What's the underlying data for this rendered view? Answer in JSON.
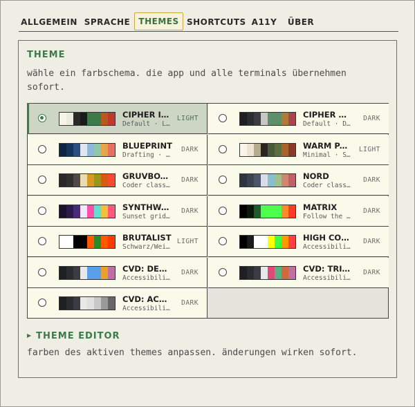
{
  "tabs": [
    {
      "label": "ALLGEMEIN",
      "active": false
    },
    {
      "label": "SPRACHE",
      "active": false
    },
    {
      "label": "THEMES",
      "active": true
    },
    {
      "label": "SHORTCUTS",
      "active": false
    },
    {
      "label": "A11Y",
      "active": false
    },
    {
      "label": "ÜBER",
      "active": false
    }
  ],
  "theme_section": {
    "title": "THEME",
    "description": "wähle ein farbschema. die app und alle terminals übernehmen sofort."
  },
  "themes": [
    {
      "name": "CIPHER IVORY",
      "sub": "Default · Light",
      "mode": "LIGHT",
      "selected": true,
      "colors": [
        "#f7f5e8",
        "#ecebdd",
        "#2a2a2a",
        "#1a1a1a",
        "#3d7a4a",
        "#3d7a4a",
        "#b85a1e",
        "#c0392b"
      ]
    },
    {
      "name": "CIPHER DARK",
      "sub": "Default · Dark",
      "mode": "DARK",
      "selected": false,
      "colors": [
        "#1e1f22",
        "#2a2c30",
        "#3a3c42",
        "#c8c8c0",
        "#5f8f6a",
        "#5f8f6a",
        "#b07a3a",
        "#a8454f"
      ]
    },
    {
      "name": "BLUEPRINT",
      "sub": "Drafting · Dark",
      "mode": "DARK",
      "selected": false,
      "colors": [
        "#0e2440",
        "#16355a",
        "#2a4f80",
        "#dfe7f2",
        "#8fb8d8",
        "#8fc8a8",
        "#e8a44a",
        "#e87060"
      ]
    },
    {
      "name": "WARM PAPER",
      "sub": "Minimal · Sepia",
      "mode": "LIGHT",
      "selected": false,
      "colors": [
        "#f8f4ea",
        "#ede5d2",
        "#b5a98e",
        "#2a2520",
        "#4a5a3a",
        "#5e6e3e",
        "#a8642a",
        "#8a3a2a"
      ]
    },
    {
      "name": "GRUVBOX DARK",
      "sub": "Coder classic",
      "mode": "DARK",
      "selected": false,
      "colors": [
        "#282828",
        "#32302f",
        "#504945",
        "#ebdbb2",
        "#d79921",
        "#98971a",
        "#d65d0e",
        "#fb4934"
      ]
    },
    {
      "name": "NORD",
      "sub": "Coder classic",
      "mode": "DARK",
      "selected": false,
      "colors": [
        "#2e3440",
        "#3b4252",
        "#4c566a",
        "#d8dee9",
        "#88c0d0",
        "#a3be8c",
        "#d08770",
        "#bf616a"
      ]
    },
    {
      "name": "SYNTHWAVE",
      "sub": "Sunset grid · Neon",
      "mode": "DARK",
      "selected": false,
      "colors": [
        "#1a1030",
        "#2b1a4a",
        "#4a2a7a",
        "#f0e8ff",
        "#ff4fa8",
        "#5fe0d0",
        "#f0c040",
        "#ff5a7a"
      ]
    },
    {
      "name": "MATRIX",
      "sub": "Follow the white rabbit",
      "mode": "DARK",
      "selected": false,
      "colors": [
        "#000000",
        "#0a1a0a",
        "#1e5a2a",
        "#4cff4c",
        "#4cff4c",
        "#4cff4c",
        "#ff8a2a",
        "#ff3a2a"
      ]
    },
    {
      "name": "BRUTALIST",
      "sub": "Schwarz/Weiß · Orange",
      "mode": "LIGHT",
      "selected": false,
      "colors": [
        "#ffffff",
        "#ffffff",
        "#000000",
        "#000000",
        "#ff5a00",
        "#2a8a2a",
        "#ff5a00",
        "#ff3a00"
      ]
    },
    {
      "name": "HIGH CONTRAST",
      "sub": "Accessibility · High",
      "mode": "DARK",
      "selected": false,
      "colors": [
        "#000000",
        "#1a1a1a",
        "#ffffff",
        "#ffffff",
        "#ffff00",
        "#40ff40",
        "#ff9a00",
        "#ff4040"
      ]
    },
    {
      "name": "CVD: DEUTERANOPIA",
      "sub": "Accessibility · CVD",
      "mode": "DARK",
      "selected": false,
      "colors": [
        "#1e1f22",
        "#2a2c30",
        "#3a3c42",
        "#e8e8e8",
        "#5aa0e8",
        "#5aa0e8",
        "#e8a030",
        "#c070a0"
      ]
    },
    {
      "name": "CVD: TRITANOPIA",
      "sub": "Accessibility · CVD",
      "mode": "DARK",
      "selected": false,
      "colors": [
        "#1e1f22",
        "#2a2c30",
        "#3a3c42",
        "#e8e8e8",
        "#e04a7a",
        "#5ab080",
        "#d06a3a",
        "#c070a0"
      ]
    },
    {
      "name": "CVD: ACHROMATOPSIA",
      "sub": "Accessibility · CVD",
      "mode": "DARK",
      "selected": false,
      "colors": [
        "#1e1f22",
        "#2a2c30",
        "#3a3c42",
        "#e8e8e8",
        "#e0e0e0",
        "#c8c8c8",
        "#999999",
        "#666666"
      ]
    }
  ],
  "editor": {
    "title": "THEME EDITOR",
    "description": "farben des aktiven themes anpassen. änderungen wirken sofort."
  },
  "colors": {
    "accent": "#3d7a4a",
    "background": "#eeeee5",
    "cell": "#fafaea",
    "selected": "#cdd5c4",
    "active_tab_border": "#c9a93a"
  },
  "icons": {
    "radio_on": "radio-selected-icon",
    "radio_off": "radio-icon",
    "expander": "triangle-right-icon"
  }
}
